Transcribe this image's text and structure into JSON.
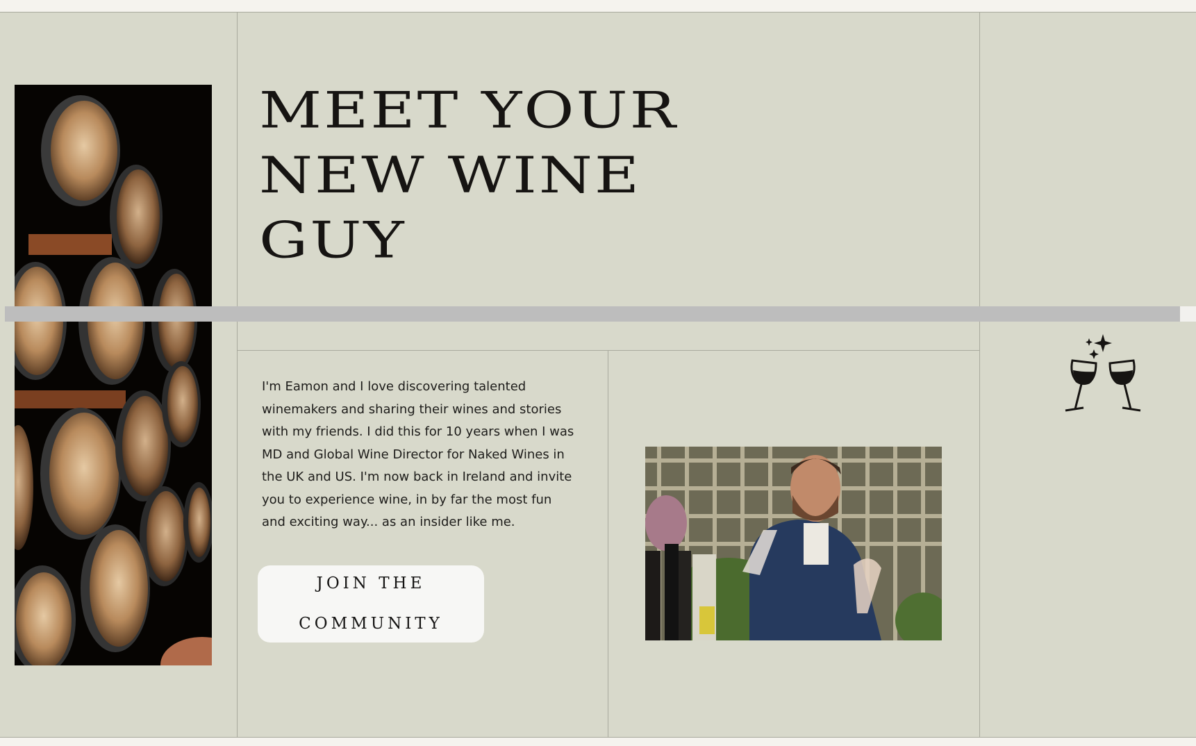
{
  "hero": {
    "title_lines": [
      "MEET YOUR",
      "NEW WINE",
      "GUY"
    ]
  },
  "intro": {
    "text": "I'm Eamon and I love discovering talented winemakers and sharing their wines and stories with my friends. I did this for 10 years when I was MD and Global Wine Director for Naked Wines in the UK and US. I'm now back in Ireland and invite you to experience wine, in by far the most fun and exciting way... as an insider like me."
  },
  "cta": {
    "line1": "JOIN THE",
    "line2": "COMMUNITY"
  },
  "images": {
    "barrels": "wine-barrels-photo",
    "portrait": "portrait-photo",
    "cheers": "wine-glasses-cheers-icon"
  },
  "colors": {
    "background": "#d8d9cb",
    "button": "#f7f7f5",
    "text": "#161412"
  }
}
